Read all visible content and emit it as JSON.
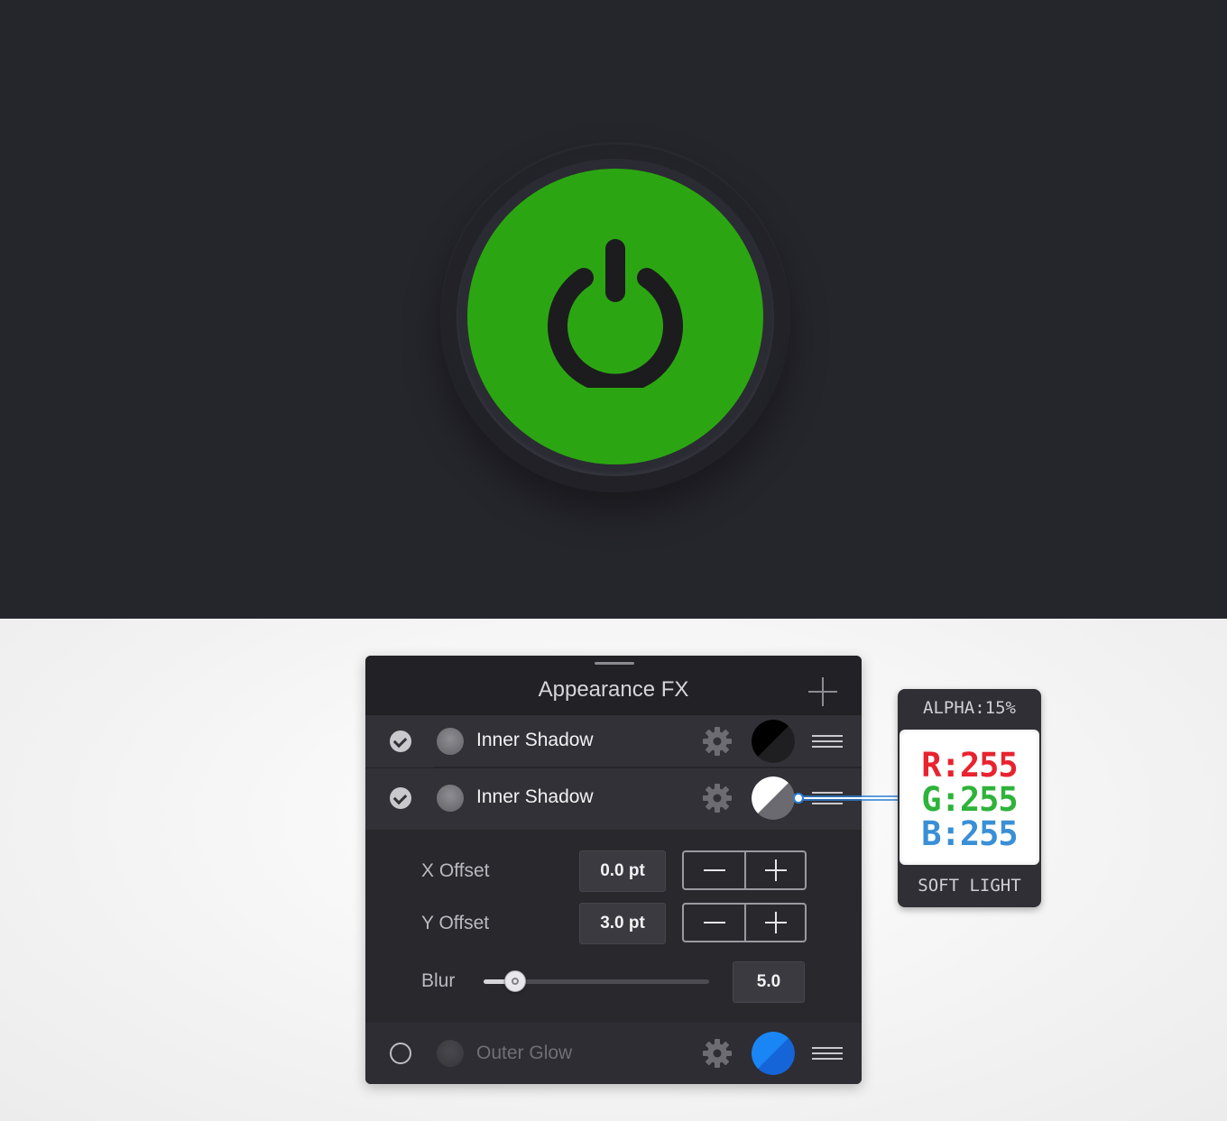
{
  "panel": {
    "title": "Appearance FX",
    "effects": [
      {
        "label": "Inner Shadow",
        "enabled": true,
        "swatch": "black-half"
      },
      {
        "label": "Inner Shadow",
        "enabled": true,
        "swatch": "white-half"
      },
      {
        "label": "Outer Glow",
        "enabled": false,
        "swatch": "blue"
      }
    ],
    "settings": {
      "x_offset_label": "X Offset",
      "x_offset_value": "0.0 pt",
      "y_offset_label": "Y Offset",
      "y_offset_value": "3.0 pt",
      "blur_label": "Blur",
      "blur_value": "5.0",
      "blur_slider_fraction": 0.14
    }
  },
  "callout": {
    "alpha": "ALPHA:15%",
    "r": "R:255",
    "g": "G:255",
    "b": "B:255",
    "blend_mode": "SOFT LIGHT"
  },
  "colors": {
    "canvas_bg": "#25252c",
    "button_green": "#2ba612",
    "panel_bg": "#242428",
    "accent_blue": "#1a7cf0"
  },
  "icons": [
    "power-icon",
    "add-icon",
    "check-icon",
    "gear-icon",
    "menu-icon",
    "minus-icon",
    "plus-icon"
  ]
}
